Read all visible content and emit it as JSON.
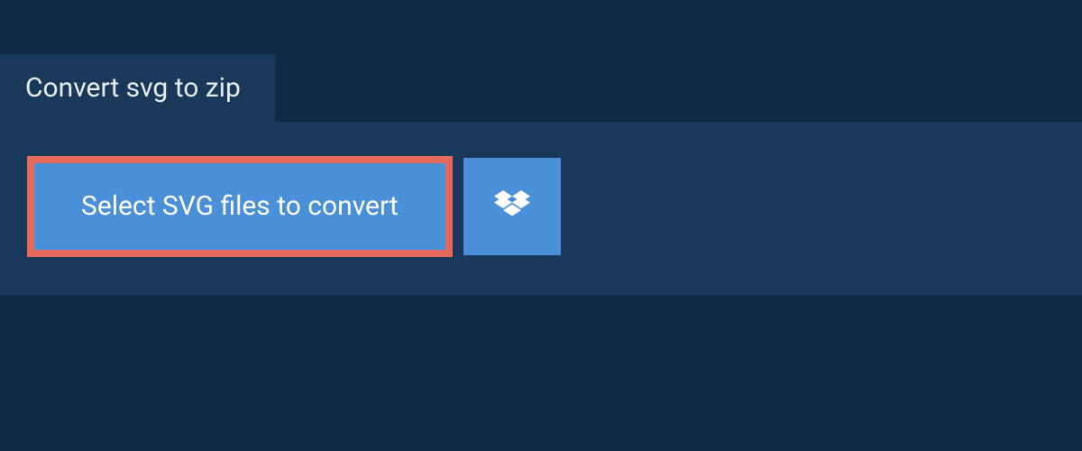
{
  "tab": {
    "label": "Convert svg to zip"
  },
  "actions": {
    "select_label": "Select SVG files to convert"
  },
  "colors": {
    "background": "#0e2a47",
    "panel": "#1a385a",
    "button": "#4a90d9",
    "highlight": "#e66a5c"
  }
}
